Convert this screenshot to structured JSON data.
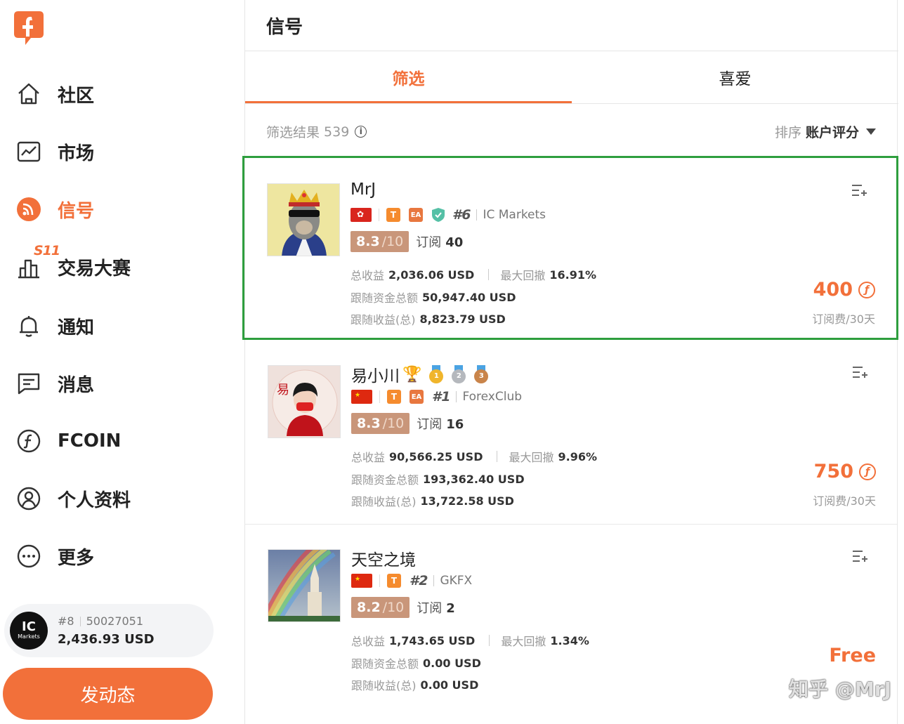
{
  "sidebar": {
    "items": [
      {
        "label": "社区",
        "icon": "home-icon"
      },
      {
        "label": "市场",
        "icon": "chart-icon"
      },
      {
        "label": "信号",
        "icon": "rss-icon",
        "active": true
      },
      {
        "label": "交易大赛",
        "icon": "bar-icon",
        "badge": "S11"
      },
      {
        "label": "通知",
        "icon": "bell-icon"
      },
      {
        "label": "消息",
        "icon": "message-icon"
      },
      {
        "label": "FCOIN",
        "icon": "fcoin-icon"
      },
      {
        "label": "个人资料",
        "icon": "profile-icon"
      },
      {
        "label": "更多",
        "icon": "more-icon"
      }
    ],
    "account": {
      "rank": "#8",
      "id": "50027051",
      "balance": "2,436.93 USD",
      "avatar_text": "IC",
      "avatar_sub": "Markets"
    },
    "post_button": "发动态"
  },
  "main": {
    "title": "信号",
    "tabs": [
      {
        "label": "筛选"
      },
      {
        "label": "喜爱"
      }
    ],
    "filter_label": "筛选结果",
    "filter_count": "539",
    "info_glyph": "i",
    "sort_label": "排序",
    "sort_value": "账户评分"
  },
  "signals": [
    {
      "name": "MrJ",
      "flag": "hk",
      "tags": [
        "T",
        "EA"
      ],
      "verified": true,
      "rank": "#6",
      "broker": "IC Markets",
      "score": "8.3",
      "score_max": "/10",
      "subs_label": "订阅",
      "subs": "40",
      "total_profit_label": "总收益",
      "total_profit": "2,036.06 USD",
      "drawdown_label": "最大回撤",
      "drawdown": "16.91%",
      "follow_funds_label": "跟随资金总额",
      "follow_funds": "50,947.40 USD",
      "follow_profit_label": "跟随收益(总)",
      "follow_profit": "8,823.79 USD",
      "price": "400",
      "price_sub": "订阅费/30天"
    },
    {
      "name": "易小川",
      "medals": [
        "1",
        "2",
        "3"
      ],
      "flag": "cn",
      "tags": [
        "T",
        "EA"
      ],
      "rank": "#1",
      "broker": "ForexClub",
      "score": "8.3",
      "score_max": "/10",
      "subs_label": "订阅",
      "subs": "16",
      "total_profit_label": "总收益",
      "total_profit": "90,566.25 USD",
      "drawdown_label": "最大回撤",
      "drawdown": "9.96%",
      "follow_funds_label": "跟随资金总额",
      "follow_funds": "193,362.40 USD",
      "follow_profit_label": "跟随收益(总)",
      "follow_profit": "13,722.58 USD",
      "price": "750",
      "price_sub": "订阅费/30天"
    },
    {
      "name": "天空之境",
      "flag": "cn",
      "tags": [
        "T"
      ],
      "rank": "#2",
      "broker": "GKFX",
      "score": "8.2",
      "score_max": "/10",
      "subs_label": "订阅",
      "subs": "2",
      "total_profit_label": "总收益",
      "total_profit": "1,743.65 USD",
      "drawdown_label": "最大回撤",
      "drawdown": "1.34%",
      "follow_funds_label": "跟随资金总额",
      "follow_funds": "0.00 USD",
      "follow_profit_label": "跟随收益(总)",
      "follow_profit": "0.00 USD",
      "price": "Free"
    }
  ],
  "watermark": "知乎 @MrJ",
  "colors": {
    "accent": "#f2703a",
    "selected_border": "#2e9e3e",
    "score_bg": "#c9967a"
  }
}
